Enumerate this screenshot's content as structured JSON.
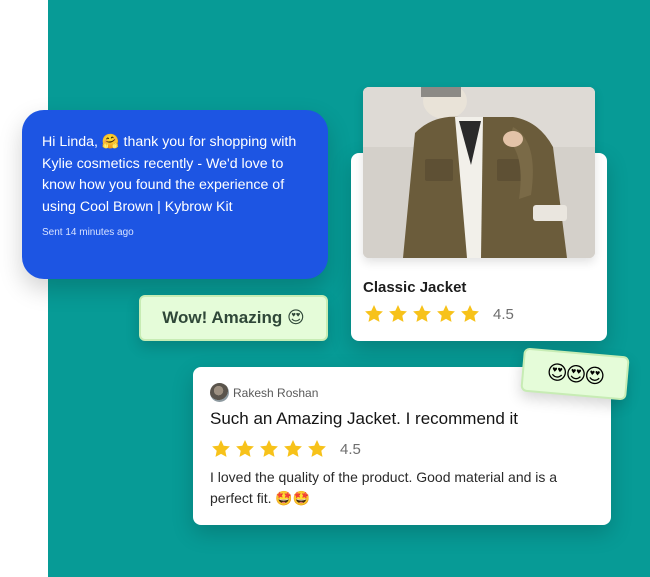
{
  "sms": {
    "text": "Hi Linda, 🤗 thank you for shopping with Kylie cosmetics recently - We'd love to know how you found the experience of using Cool Brown | Kybrow Kit",
    "time": "Sent 14 minutes ago"
  },
  "reaction_chip": {
    "text": "Wow! Amazing 😍"
  },
  "product": {
    "title": "Classic Jacket",
    "rating": 4.5,
    "rating_text": "4.5"
  },
  "review": {
    "reviewer": "Rakesh Roshan",
    "title": "Such an Amazing Jacket. I recommend it",
    "rating": 4.5,
    "rating_text": "4.5",
    "body": "I loved the quality of the product. Good material and is a perfect fit. 🤩🤩"
  },
  "emoji_chip": {
    "text": "😍😍😍"
  },
  "colors": {
    "teal_background": "#079b96",
    "sms_blue": "#1d55e3",
    "chip_green": "#e5fcd9",
    "star_yellow": "#f7c21a"
  },
  "icons": {
    "star": "star-icon",
    "avatar": "avatar"
  }
}
